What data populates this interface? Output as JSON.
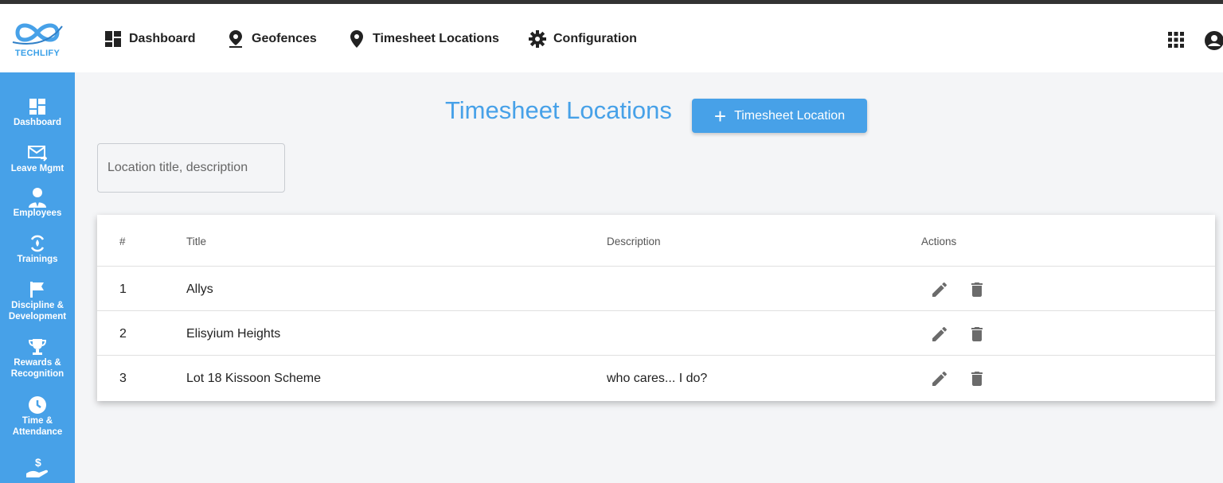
{
  "brand": {
    "name": "TECHLIFY",
    "color": "#47a1e8"
  },
  "topnav": {
    "items": [
      {
        "label": "Dashboard",
        "icon": "dashboard-icon"
      },
      {
        "label": "Geofences",
        "icon": "map-pin-icon"
      },
      {
        "label": "Timesheet Locations",
        "icon": "location-pin-icon"
      },
      {
        "label": "Configuration",
        "icon": "gear-icon"
      }
    ],
    "right_icons": [
      "apps-grid-icon",
      "account-circle-icon"
    ]
  },
  "sidebar": {
    "items": [
      {
        "label": "Dashboard",
        "icon": "dashboard-icon"
      },
      {
        "label": "Leave Mgmt",
        "icon": "mail-forward-icon"
      },
      {
        "label": "Employees",
        "icon": "employee-icon"
      },
      {
        "label": "Trainings",
        "icon": "training-icon"
      },
      {
        "label": "Discipline &\nDevelopment",
        "icon": "flag-icon"
      },
      {
        "label": "Rewards &\nRecognition",
        "icon": "trophy-icon"
      },
      {
        "label": "Time &\nAttendance",
        "icon": "clock-icon"
      },
      {
        "label": "",
        "icon": "payroll-hand-icon"
      }
    ]
  },
  "page": {
    "title": "Timesheet Locations",
    "add_button_label": "Timesheet Location",
    "search_placeholder": "Location title, description"
  },
  "table": {
    "headers": {
      "num": "#",
      "title": "Title",
      "description": "Description",
      "actions": "Actions"
    },
    "rows": [
      {
        "num": "1",
        "title": "Allys",
        "description": ""
      },
      {
        "num": "2",
        "title": "Elisyium Heights",
        "description": ""
      },
      {
        "num": "3",
        "title": "Lot 18 Kissoon Scheme",
        "description": "who cares... I do?"
      }
    ]
  }
}
